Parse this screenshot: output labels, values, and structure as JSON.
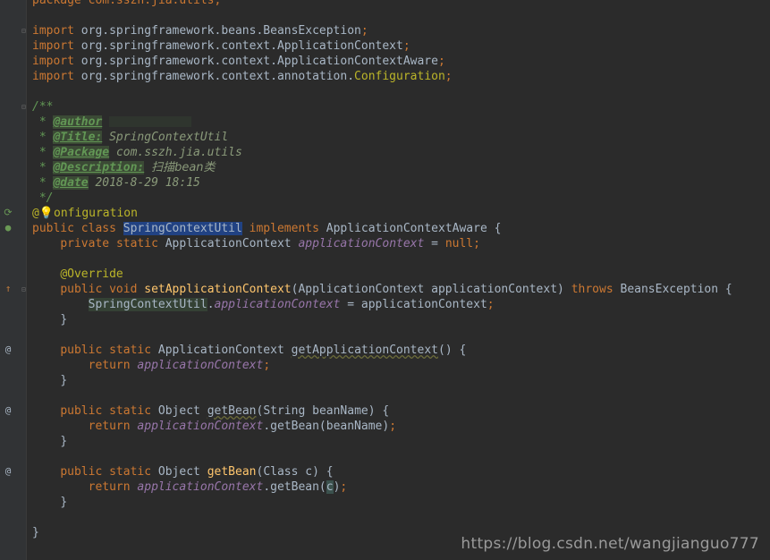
{
  "editor": {
    "line_top": "package com.sszh.jia.utils;",
    "import_kw": "import",
    "imports": [
      {
        "pkg": "org.springframework.beans.BeansException",
        "semi": ";"
      },
      {
        "pkg": "org.springframework.context.ApplicationContext",
        "semi": ";"
      },
      {
        "pkg": "org.springframework.context.ApplicationContextAware",
        "semi": ";"
      },
      {
        "pkg": "org.springframework.context.annotation.",
        "cls": "Configuration",
        "semi": ";"
      }
    ],
    "javadoc": {
      "open": "/**",
      "star": " * ",
      "close": " */",
      "author_tag": "@author",
      "title_tag": "@Title:",
      "title_val": "SpringContextUtil",
      "package_tag": "@Package",
      "package_val": "com.sszh.jia.utils",
      "desc_tag": "@Description:",
      "desc_val": "扫描bean类",
      "date_tag": "@date",
      "date_val": "2018-8-29 18:15"
    },
    "annotation_at": "@",
    "annotation_rest": "onfiguration",
    "class_line": {
      "public": "public",
      "class": "class",
      "name": "SpringContextUtil",
      "implements": "implements",
      "iface": "ApplicationContextAware",
      "brace": " {"
    },
    "field_line": {
      "private": "private",
      "static": "static",
      "type": "ApplicationContext",
      "name": "applicationContext",
      "eq": " = ",
      "null": "null",
      "semi": ";"
    },
    "override": "@Override",
    "set_method": {
      "public": "public",
      "void": "void",
      "name": "setApplicationContext",
      "params": "(ApplicationContext applicationContext) ",
      "throws": "throws",
      "exc": " BeansException {",
      "body_cls": "SpringContextUtil",
      "body_dot": ".",
      "body_fld": "applicationContext",
      "body_rest": " = applicationContext",
      "semi": ";"
    },
    "close_brace": "}",
    "get_ctx": {
      "public": "public",
      "static": "static",
      "type": "ApplicationContext",
      "name": "getApplicationContext",
      "params": "() {",
      "return": "return",
      "fld": "applicationContext",
      "semi": ";"
    },
    "get_bean_name": {
      "public": "public",
      "static": "static",
      "type": "Object",
      "name": "getBean",
      "params": "(String beanName) {",
      "return": "return",
      "fld": "applicationContext",
      "call": ".getBean(beanName)",
      "semi": ";"
    },
    "get_bean_class": {
      "public": "public",
      "static": "static",
      "type": "Object",
      "name": "getBean",
      "params": "(Class c) {",
      "return": "return",
      "fld": "applicationContext",
      "call_open": ".getBean(",
      "arg": "c",
      "call_close": ")",
      "semi": ";"
    }
  },
  "gutter_icons": {
    "implements": "implements-icon",
    "override": "override-icon",
    "annotation": "at-icon"
  },
  "watermark": "https://blog.csdn.net/wangjianguo777"
}
